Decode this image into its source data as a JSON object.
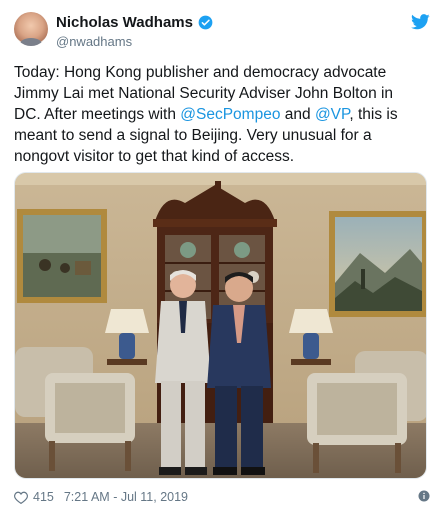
{
  "author": {
    "name": "Nicholas Wadhams",
    "handle": "@nwadhams"
  },
  "tweet": {
    "text_1": "Today: Hong Kong publisher and democracy advocate Jimmy Lai met National Security Adviser John Bolton in DC. After meetings with ",
    "mention_1": "@SecPompeo",
    "text_2": " and ",
    "mention_2": "@VP",
    "text_3": ", this is meant to send a signal to Beijing. Very unusual for a nongovt visitor to get that kind of access."
  },
  "footer": {
    "likes": "415",
    "timestamp": "7:21 AM - Jul 11, 2019"
  },
  "colors": {
    "link": "#1b95e0",
    "heart": "#657786"
  },
  "icons": [
    "verified-badge-icon",
    "twitter-bird-icon",
    "heart-icon",
    "info-icon"
  ]
}
